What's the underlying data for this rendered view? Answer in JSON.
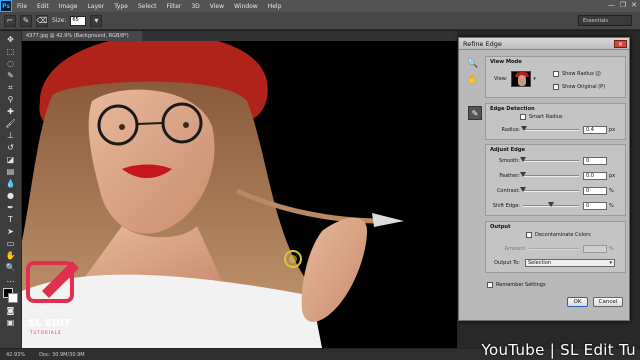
{
  "app": {
    "logo": "Ps"
  },
  "menu": [
    "File",
    "Edit",
    "Image",
    "Layer",
    "Type",
    "Select",
    "Filter",
    "3D",
    "View",
    "Window",
    "Help"
  ],
  "window_controls": [
    "—",
    "❐",
    "✕"
  ],
  "options_bar": {
    "size_label": "Size:",
    "size_value": "65",
    "workspace": "Essentials"
  },
  "document_tab": "4377.jpg @ 42.9% (Background, RGB/8*)",
  "status": {
    "zoom": "42.93%",
    "doc": "Doc: 30.9M/30.9M"
  },
  "dialog": {
    "title": "Refine Edge",
    "close": "✕",
    "view_mode": {
      "title": "View Mode",
      "view_label": "View:",
      "show_radius": "Show Radius (J)",
      "show_original": "Show Original (P)"
    },
    "edge_detection": {
      "title": "Edge Detection",
      "smart_radius": "Smart Radius",
      "radius_label": "Radius:",
      "radius_value": "0.4",
      "radius_unit": "px",
      "radius_level": 0.01
    },
    "adjust_edge": {
      "title": "Adjust Edge",
      "smooth_label": "Smooth:",
      "smooth_value": "0",
      "smooth_level": 0,
      "feather_label": "Feather:",
      "feather_value": "0.0",
      "feather_unit": "px",
      "feather_level": 0,
      "contrast_label": "Contrast:",
      "contrast_value": "0",
      "contrast_unit": "%",
      "contrast_level": 0,
      "shift_label": "Shift Edge:",
      "shift_value": "0",
      "shift_unit": "%",
      "shift_level": 0.5
    },
    "output": {
      "title": "Output",
      "decontaminate": "Decontaminate Colors",
      "amount_label": "Amount:",
      "amount_unit": "%",
      "output_to_label": "Output To:",
      "output_to_value": "Selection"
    },
    "remember": "Remember Settings",
    "ok": "OK",
    "cancel": "Cancel"
  },
  "logo": {
    "name": "SL EDIT",
    "tagline": "TUTORIALS"
  },
  "watermark": "YouTube | SL Edit Tu",
  "colors": {
    "menubar": "#535353",
    "dialog_bg": "#b9b9b9",
    "hat": "#b0231a",
    "logo_pink": "#e03050"
  }
}
